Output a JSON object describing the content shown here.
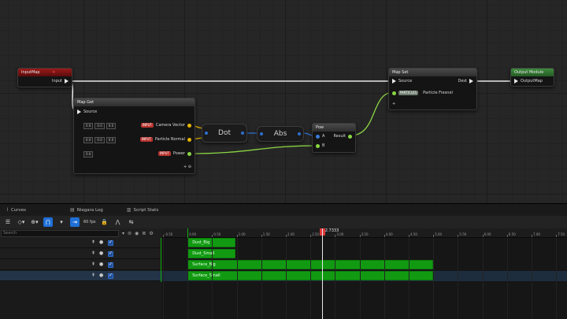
{
  "graph": {
    "input_map": {
      "title": "InputMap",
      "close": "×",
      "pin": "Input"
    },
    "map_get": {
      "title": "Map Get",
      "source": "Source",
      "rows": [
        {
          "values": [
            "0.0",
            "0.0",
            "0.0"
          ],
          "tag": "INPUT",
          "label": "Camera Vector"
        },
        {
          "values": [
            "0.0",
            "0.0",
            "0.0"
          ],
          "tag": "INPUT",
          "label": "Particle Normal"
        },
        {
          "values": [
            "0.0"
          ],
          "tag": "INPUT",
          "label": "Power"
        }
      ],
      "add": "+ ⊖"
    },
    "dot": {
      "label": "Dot"
    },
    "abs": {
      "label": "Abs"
    },
    "pow": {
      "title": "Pow",
      "a": "A",
      "b": "B",
      "result": "Result"
    },
    "map_set": {
      "title": "Map Set",
      "source": "Source",
      "dest": "Dest",
      "tag": "PARTICLES",
      "label": "Particle Fresnel",
      "add": "+"
    },
    "output": {
      "title": "Output Module",
      "pin": "OutputMap"
    }
  },
  "tabs": [
    {
      "icon": "curves-icon",
      "glyph": "⌇",
      "label": "Curves"
    },
    {
      "icon": "log-icon",
      "glyph": "▤",
      "label": "Niagara Log"
    },
    {
      "icon": "stats-icon",
      "glyph": "▥",
      "label": "Script Stats"
    }
  ],
  "toolbar": {
    "fps": "60 fps"
  },
  "search": {
    "placeholder": "Search"
  },
  "playhead": {
    "time": "2.7333"
  },
  "ruler_ticks": [
    "-0.50",
    "0.00",
    "0.50",
    "1.00",
    "1.50",
    "2.00",
    "2.50",
    "3.00",
    "3.50",
    "4.00",
    "4.50",
    "5.00",
    "5.50",
    "6.00",
    "6.50",
    "7.00",
    "7.50"
  ],
  "clips": [
    {
      "label": "Dust_Big",
      "start": 0.0,
      "end": 0.98
    },
    {
      "label": "Dust_Small",
      "start": 0.0,
      "end": 0.98
    },
    {
      "label": "Surface_Big",
      "start": 0.0,
      "end": 5.0
    },
    {
      "label": "Surface_Small",
      "start": 0.0,
      "end": 5.0
    }
  ],
  "colors": {
    "clip": "#119a11",
    "playhead": "#e03a3a",
    "accent": "#1f6fd6"
  }
}
